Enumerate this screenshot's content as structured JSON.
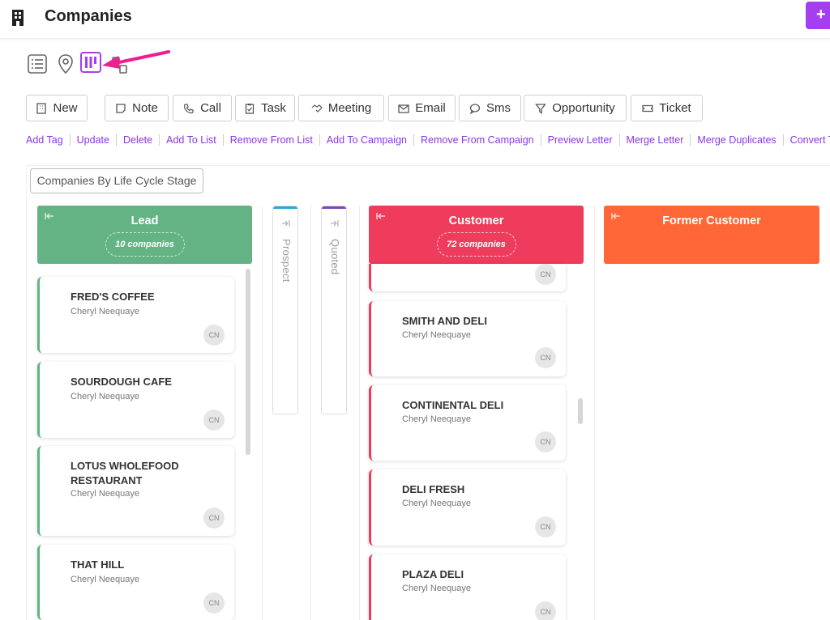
{
  "page": {
    "title": "Companies",
    "plus_label": "+"
  },
  "actions": {
    "new": "New",
    "note": "Note",
    "call": "Call",
    "task": "Task",
    "meeting": "Meeting",
    "email": "Email",
    "sms": "Sms",
    "opportunity": "Opportunity",
    "ticket": "Ticket"
  },
  "links": [
    "Add Tag",
    "Update",
    "Delete",
    "Add To List",
    "Remove From List",
    "Add To Campaign",
    "Remove From Campaign",
    "Preview Letter",
    "Merge Letter",
    "Merge Duplicates",
    "Convert To Contact"
  ],
  "board": {
    "group_by_label": "Companies By Life Cycle Stage",
    "columns": {
      "lead": {
        "name": "Lead",
        "count": "10 companies",
        "color": "#63b384"
      },
      "prospect": {
        "name": "Prospect",
        "color": "#2aa6d8"
      },
      "quoted": {
        "name": "Quoted",
        "color": "#7b47b8"
      },
      "customer": {
        "name": "Customer",
        "count": "72 companies",
        "color": "#f03c5c"
      },
      "former": {
        "name": "Former Customer",
        "color": "#ff6739"
      }
    },
    "lead_cards": [
      {
        "name": "FRED'S COFFEE",
        "owner": "Cheryl Neequaye",
        "initials": "CN"
      },
      {
        "name": "SOURDOUGH CAFE",
        "owner": "Cheryl Neequaye",
        "initials": "CN"
      },
      {
        "name": "LOTUS WHOLEFOOD RESTAURANT",
        "owner": "Cheryl Neequaye",
        "initials": "CN"
      },
      {
        "name": "THAT HILL",
        "owner": "Cheryl Neequaye",
        "initials": "CN"
      }
    ],
    "customer_cards": [
      {
        "name": "",
        "owner": "",
        "initials": "CN"
      },
      {
        "name": "SMITH AND DELI",
        "owner": "Cheryl Neequaye",
        "initials": "CN"
      },
      {
        "name": "CONTINENTAL DELI",
        "owner": "Cheryl Neequaye",
        "initials": "CN"
      },
      {
        "name": "DELI FRESH",
        "owner": "Cheryl Neequaye",
        "initials": "CN"
      },
      {
        "name": "PLAZA DELI",
        "owner": "Cheryl Neequaye",
        "initials": "CN"
      }
    ]
  },
  "colors": {
    "accent": "#a53ef0",
    "link": "#8d35e8",
    "arrow": "#ee1f8e"
  }
}
